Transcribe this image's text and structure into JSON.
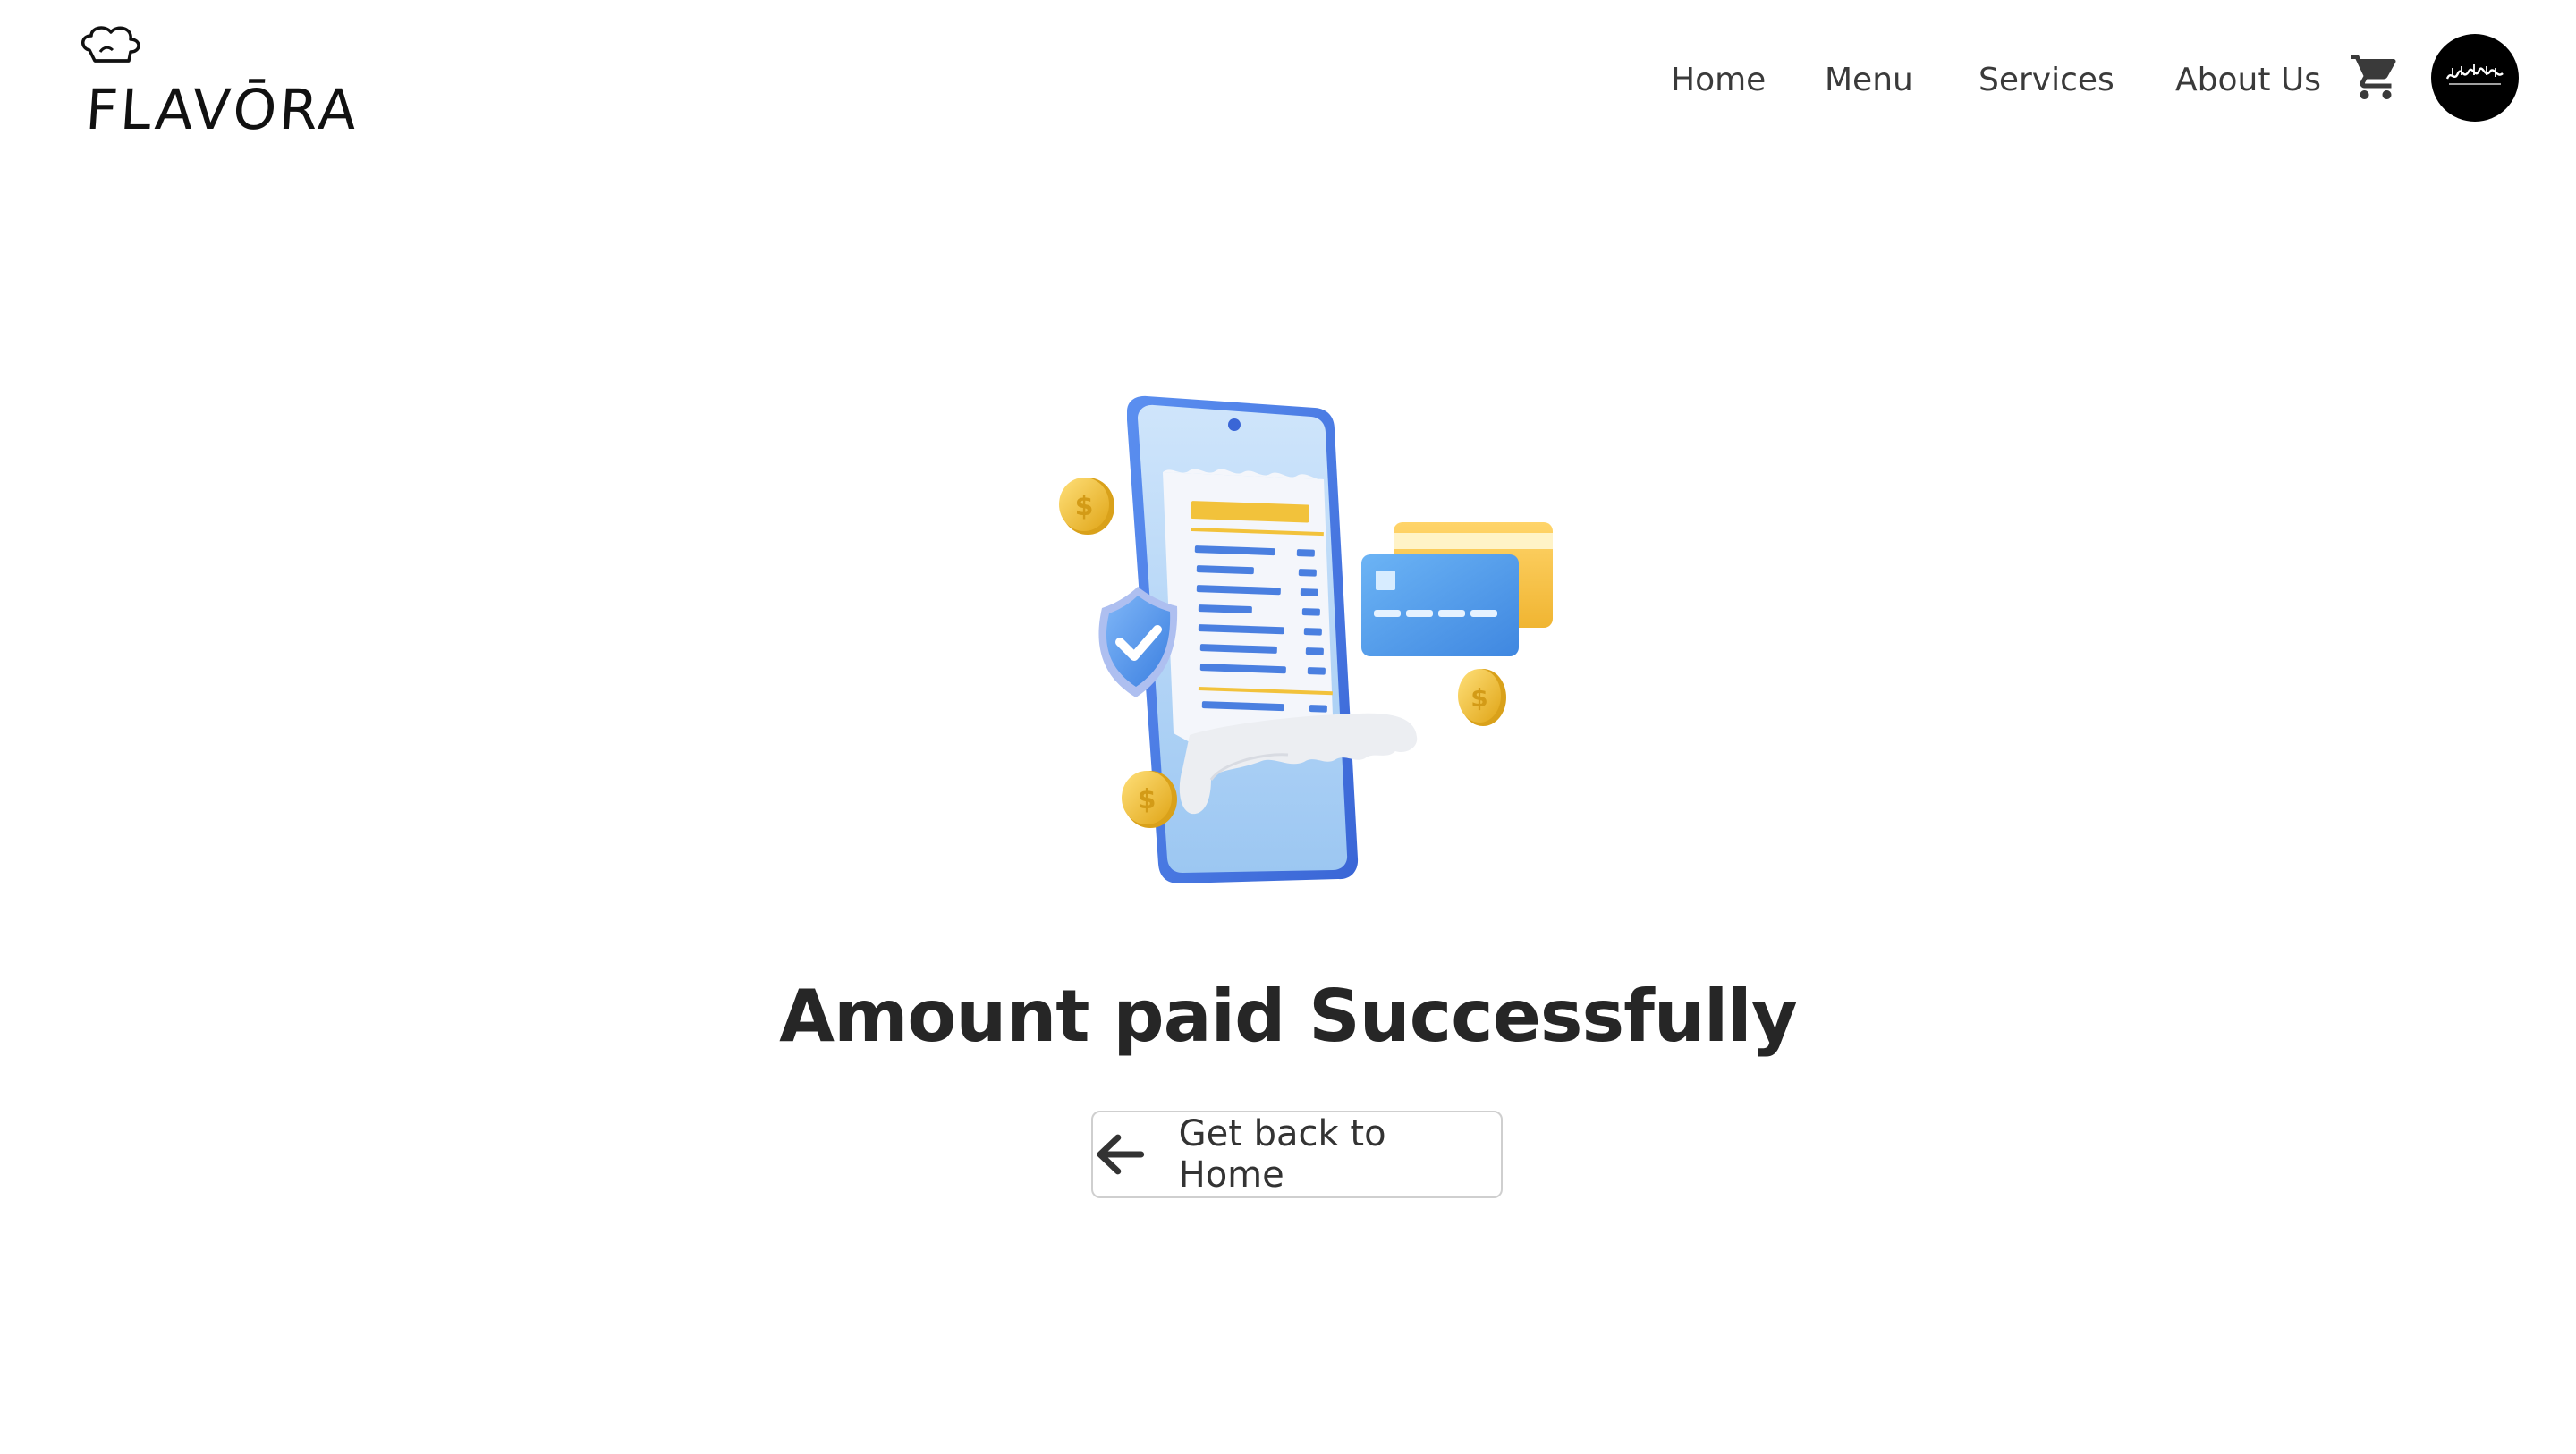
{
  "brand": {
    "name": "FLAVŌRA",
    "logo_icon": "chef-hat-icon"
  },
  "nav": {
    "items": [
      {
        "label": "Home"
      },
      {
        "label": "Menu"
      },
      {
        "label": "Services"
      },
      {
        "label": "About Us"
      }
    ],
    "cart_icon": "cart-icon",
    "avatar_icon": "profile-avatar"
  },
  "main": {
    "illustration": "payment-success-illustration",
    "title": "Amount paid Successfully",
    "back_button": {
      "label": "Get back to Home",
      "icon": "arrow-left-icon"
    }
  },
  "colors": {
    "background": "#ffffff",
    "text": "#262626",
    "phone_blue": "#4a7fe0",
    "card_blue": "#4e9ae8",
    "coin_gold": "#f2c23b",
    "avatar_bg": "#000000"
  }
}
